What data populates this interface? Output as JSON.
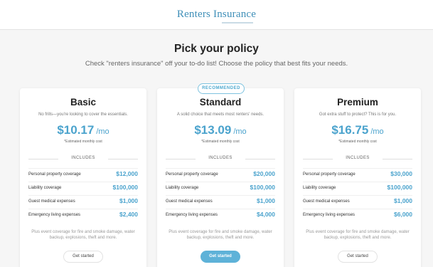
{
  "header": {
    "brand": "Renters Insurance"
  },
  "main": {
    "title": "Pick your policy",
    "subtitle": "Check \"renters insurance\" off your to-do list! Choose the policy that best fits your needs."
  },
  "badge": {
    "label": "RECOMMENDED"
  },
  "colors": {
    "accent": "#4ba3cd",
    "button_filled": "#5eb2d8"
  },
  "includes_label": "INCLUDES",
  "plans": [
    {
      "name": "Basic",
      "description": "No frills—you're looking to cover the essentials.",
      "price": "$10.17",
      "per": "/mo",
      "estimate_note": "*Estimated monthly cost",
      "coverage": [
        {
          "label": "Personal property coverage",
          "amount": "$12,000"
        },
        {
          "label": "Liability coverage",
          "amount": "$100,000"
        },
        {
          "label": "Guest medical expenses",
          "amount": "$1,000"
        },
        {
          "label": "Emergency living expenses",
          "amount": "$2,400"
        }
      ],
      "extra": "Plus event coverage for fire and smoke damage, water backup, explosions, theft and more.",
      "cta": "Get started"
    },
    {
      "name": "Standard",
      "description": "A solid choice that meets most renters' needs.",
      "price": "$13.09",
      "per": "/mo",
      "estimate_note": "*Estimated monthly cost",
      "coverage": [
        {
          "label": "Personal property coverage",
          "amount": "$20,000"
        },
        {
          "label": "Liability coverage",
          "amount": "$100,000"
        },
        {
          "label": "Guest medical expenses",
          "amount": "$1,000"
        },
        {
          "label": "Emergency living expenses",
          "amount": "$4,000"
        }
      ],
      "extra": "Plus event coverage for fire and smoke damage, water backup, explosions, theft and more.",
      "cta": "Get started"
    },
    {
      "name": "Premium",
      "description": "Got extra stuff to protect? This is for you.",
      "price": "$16.75",
      "per": "/mo",
      "estimate_note": "*Estimated monthly cost",
      "coverage": [
        {
          "label": "Personal property coverage",
          "amount": "$30,000"
        },
        {
          "label": "Liability coverage",
          "amount": "$100,000"
        },
        {
          "label": "Guest medical expenses",
          "amount": "$1,000"
        },
        {
          "label": "Emergency living expenses",
          "amount": "$6,000"
        }
      ],
      "extra": "Plus event coverage for fire and smoke damage, water backup, explosions, theft and more.",
      "cta": "Get started"
    }
  ]
}
